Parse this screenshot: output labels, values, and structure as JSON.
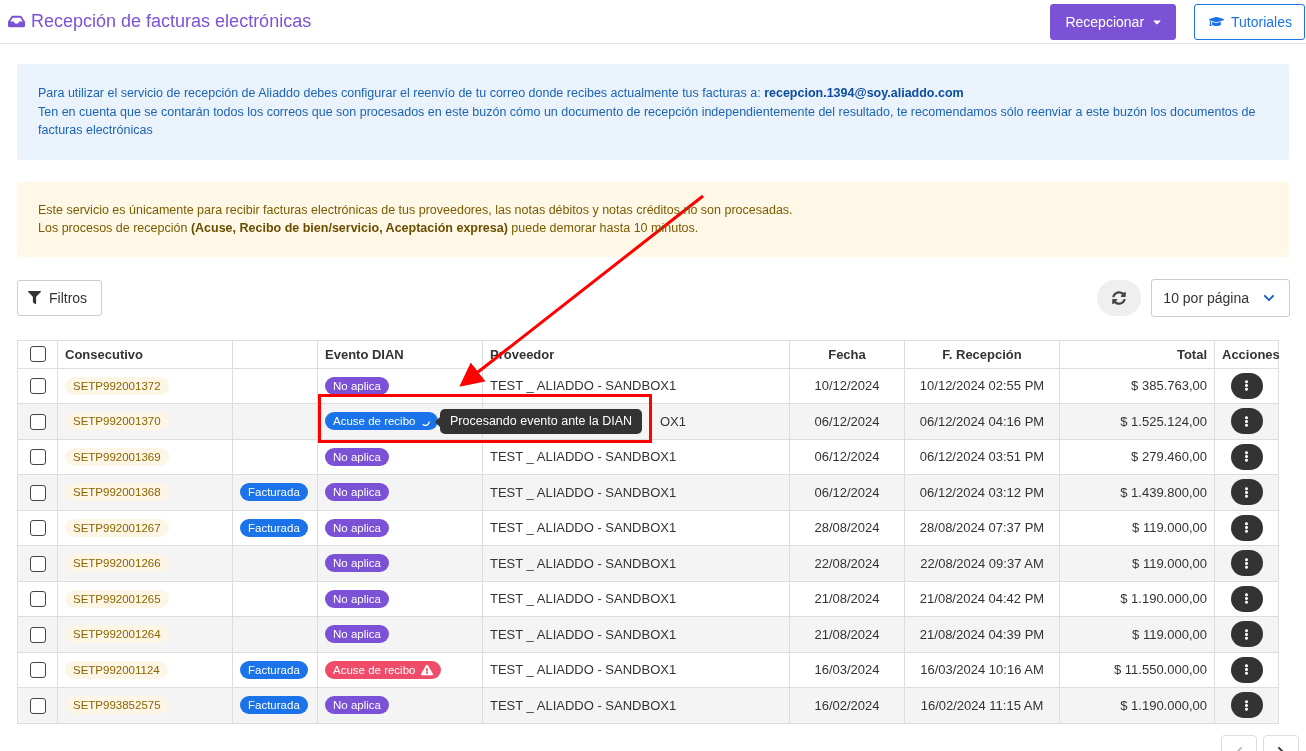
{
  "header": {
    "title": "Recepción de facturas electrónicas",
    "buttons": [
      {
        "label": "Recepcionar",
        "kind": "dropdown"
      },
      {
        "label": "Tutoriales",
        "kind": "outline"
      }
    ]
  },
  "info_alert": {
    "line1": "Para utilizar el servicio de recepción de Aliaddo debes configurar el reenvío de tu correo donde recibes actualmente tus facturas a: **recepcion.1394@soy.aliaddo.com**",
    "line2": "Ten en cuenta que se contarán todos los correos que son procesados en este buzón cómo un documento de recepción independientemente del resultado, te recomendamos sólo reenviar a este buzón los documentos de facturas electrónicas"
  },
  "warning_alert": {
    "line1": "Este servicio es únicamente para recibir facturas electrónicas de tus proveedores, las notas débitos y notas créditos no son procesadas.",
    "line2": "Los procesos de recepción **(Acuse, Recibo de bien/servicio, Aceptación expresa)** puede demorar hasta 10 minutos."
  },
  "toolbar": {
    "filter_button": "Filtros",
    "page_size": "10 por página"
  },
  "table": {
    "select_all_checked": false,
    "columns": [
      {
        "label": "Consecutivo"
      },
      {},
      {
        "label": "Evento DIAN"
      },
      {
        "label": "Proveedor"
      },
      {
        "label": "Fecha"
      },
      {
        "label": "F. Recepción"
      },
      {
        "label": "Total"
      },
      {
        "label": "Acciones"
      }
    ],
    "rows": [
      {
        "checked": false,
        "consecutivo": "SETP992001372",
        "event": {
          "label": "No aplica",
          "kind": "none"
        },
        "proveedor": "TEST _ ALIADDO - SANDBOX1",
        "fecha": "10/12/2024",
        "recepcion": "10/12/2024 02:55 PM",
        "total": "$ 385.763,00"
      },
      {
        "checked": false,
        "consecutivo": "SETP992001370",
        "event": {
          "label": "Acuse de recibo",
          "kind": "processing",
          "tooltip": "Procesando evento ante la DIAN"
        },
        "proveedor": "OX1",
        "fecha": "06/12/2024",
        "recepcion": "06/12/2024 04:16 PM",
        "total": "$ 1.525.124,00"
      },
      {
        "checked": false,
        "consecutivo": "SETP992001369",
        "event": {
          "label": "No aplica",
          "kind": "none"
        },
        "proveedor": "TEST _ ALIADDO - SANDBOX1",
        "fecha": "06/12/2024",
        "recepcion": "06/12/2024 03:51 PM",
        "total": "$ 279.460,00"
      },
      {
        "checked": false,
        "consecutivo": "SETP992001368",
        "status": "Facturada",
        "event": {
          "label": "No aplica",
          "kind": "none"
        },
        "proveedor": "TEST _ ALIADDO - SANDBOX1",
        "fecha": "06/12/2024",
        "recepcion": "06/12/2024 03:12 PM",
        "total": "$ 1.439.800,00"
      },
      {
        "checked": false,
        "consecutivo": "SETP992001267",
        "status": "Facturada",
        "event": {
          "label": "No aplica",
          "kind": "none"
        },
        "proveedor": "TEST _ ALIADDO - SANDBOX1",
        "fecha": "28/08/2024",
        "recepcion": "28/08/2024 07:37 PM",
        "total": "$ 119.000,00"
      },
      {
        "checked": false,
        "consecutivo": "SETP992001266",
        "event": {
          "label": "No aplica",
          "kind": "none"
        },
        "proveedor": "TEST _ ALIADDO - SANDBOX1",
        "fecha": "22/08/2024",
        "recepcion": "22/08/2024 09:37 AM",
        "total": "$ 119.000,00"
      },
      {
        "checked": false,
        "consecutivo": "SETP992001265",
        "event": {
          "label": "No aplica",
          "kind": "none"
        },
        "proveedor": "TEST _ ALIADDO - SANDBOX1",
        "fecha": "21/08/2024",
        "recepcion": "21/08/2024 04:42 PM",
        "total": "$ 1.190.000,00"
      },
      {
        "checked": false,
        "consecutivo": "SETP992001264",
        "event": {
          "label": "No aplica",
          "kind": "none"
        },
        "proveedor": "TEST _ ALIADDO - SANDBOX1",
        "fecha": "21/08/2024",
        "recepcion": "21/08/2024 04:39 PM",
        "total": "$ 119.000,00"
      },
      {
        "checked": false,
        "consecutivo": "SETP992001124",
        "status": "Facturada",
        "event": {
          "label": "Acuse de recibo",
          "kind": "error"
        },
        "proveedor": "TEST _ ALIADDO - SANDBOX1",
        "fecha": "16/03/2024",
        "recepcion": "16/03/2024 10:16 AM",
        "total": "$ 11.550.000,00"
      },
      {
        "checked": false,
        "consecutivo": "SETP993852575",
        "status": "Facturada",
        "event": {
          "label": "No aplica",
          "kind": "none"
        },
        "proveedor": "TEST _ ALIADDO - SANDBOX1",
        "fecha": "16/02/2024",
        "recepcion": "16/02/2024 11:15 AM",
        "total": "$ 1.190.000,00"
      }
    ]
  },
  "pagination": {
    "previous_disabled": true,
    "next_disabled": false
  }
}
